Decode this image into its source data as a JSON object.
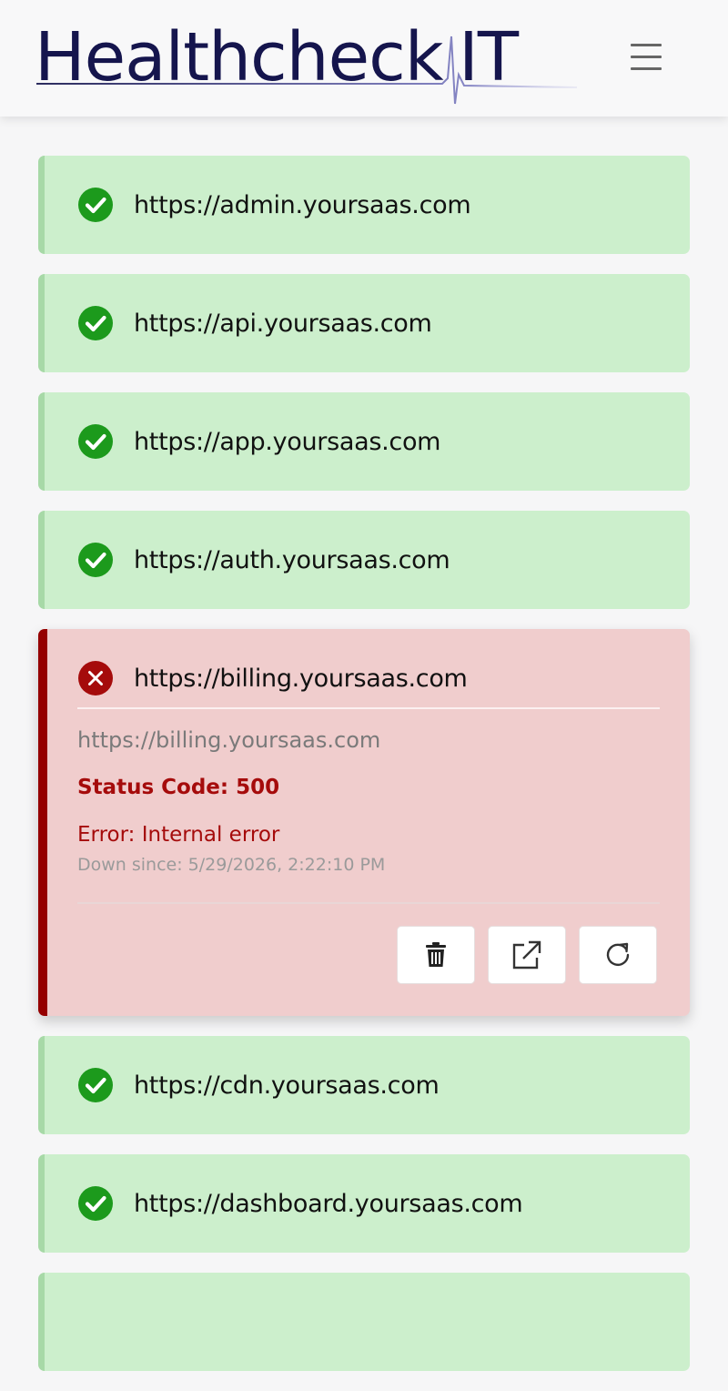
{
  "header": {
    "logo_text_1": "Healthcheck",
    "logo_text_2": "IT",
    "menu_icon": "hamburger-menu-icon"
  },
  "colors": {
    "up_bg": "#ccefcc",
    "up_border": "#a7d9a7",
    "check_green": "#1c9a1c",
    "down_bg": "#f0cdcd",
    "down_border": "#950000",
    "error_red": "#a50b0b",
    "logo_navy": "#15154d"
  },
  "services": [
    {
      "url": "https://admin.yoursaas.com",
      "status": "up"
    },
    {
      "url": "https://api.yoursaas.com",
      "status": "up"
    },
    {
      "url": "https://app.yoursaas.com",
      "status": "up"
    },
    {
      "url": "https://auth.yoursaas.com",
      "status": "up"
    },
    {
      "url": "https://billing.yoursaas.com",
      "status": "down"
    },
    {
      "url": "https://cdn.yoursaas.com",
      "status": "up"
    },
    {
      "url": "https://dashboard.yoursaas.com",
      "status": "up"
    },
    {
      "url": "",
      "status": "up"
    }
  ],
  "expanded": {
    "detail_url": "https://billing.yoursaas.com",
    "status_code": "Status Code: 500",
    "error": "Error: Internal error",
    "down_since": "Down since: 5/29/2026, 2:22:10 PM",
    "actions": [
      {
        "icon": "trash-icon"
      },
      {
        "icon": "external-link-icon"
      },
      {
        "icon": "refresh-icon"
      }
    ]
  }
}
